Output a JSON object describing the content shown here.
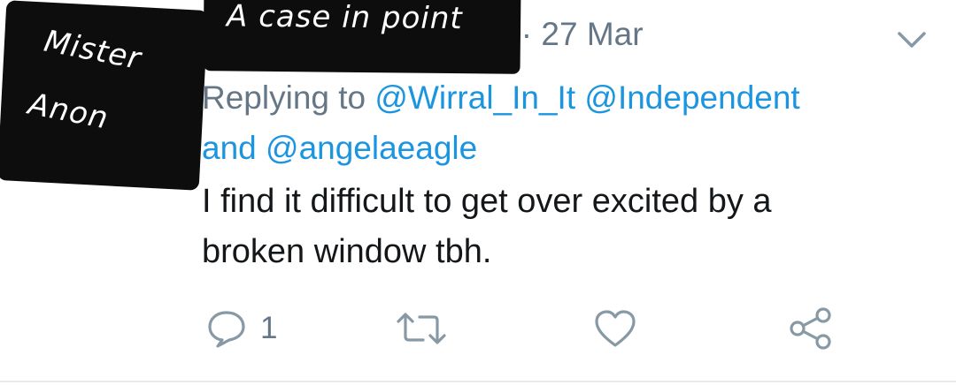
{
  "tweet": {
    "header_meta": "c · 27 Mar",
    "reply_context": {
      "prefix": "Replying to",
      "mentions": [
        "@Wirral_In_It",
        "@Independent",
        "@angelaeagle"
      ],
      "joiner": "and"
    },
    "text_line1": "I find it difficult to get over excited by a",
    "text_line2": "broken window tbh.",
    "actions": {
      "reply_count": "1"
    }
  },
  "overlays": {
    "caption": "A case in point",
    "name_line1": "Mister",
    "name_line2": "Anon"
  },
  "colors": {
    "link": "#1b95e0",
    "secondary_text": "#657786",
    "primary_text": "#14171a",
    "overlay_bg": "#0d0d0d"
  },
  "icons": [
    "chevron-down-icon",
    "reply-icon",
    "retweet-icon",
    "like-icon",
    "share-icon"
  ]
}
